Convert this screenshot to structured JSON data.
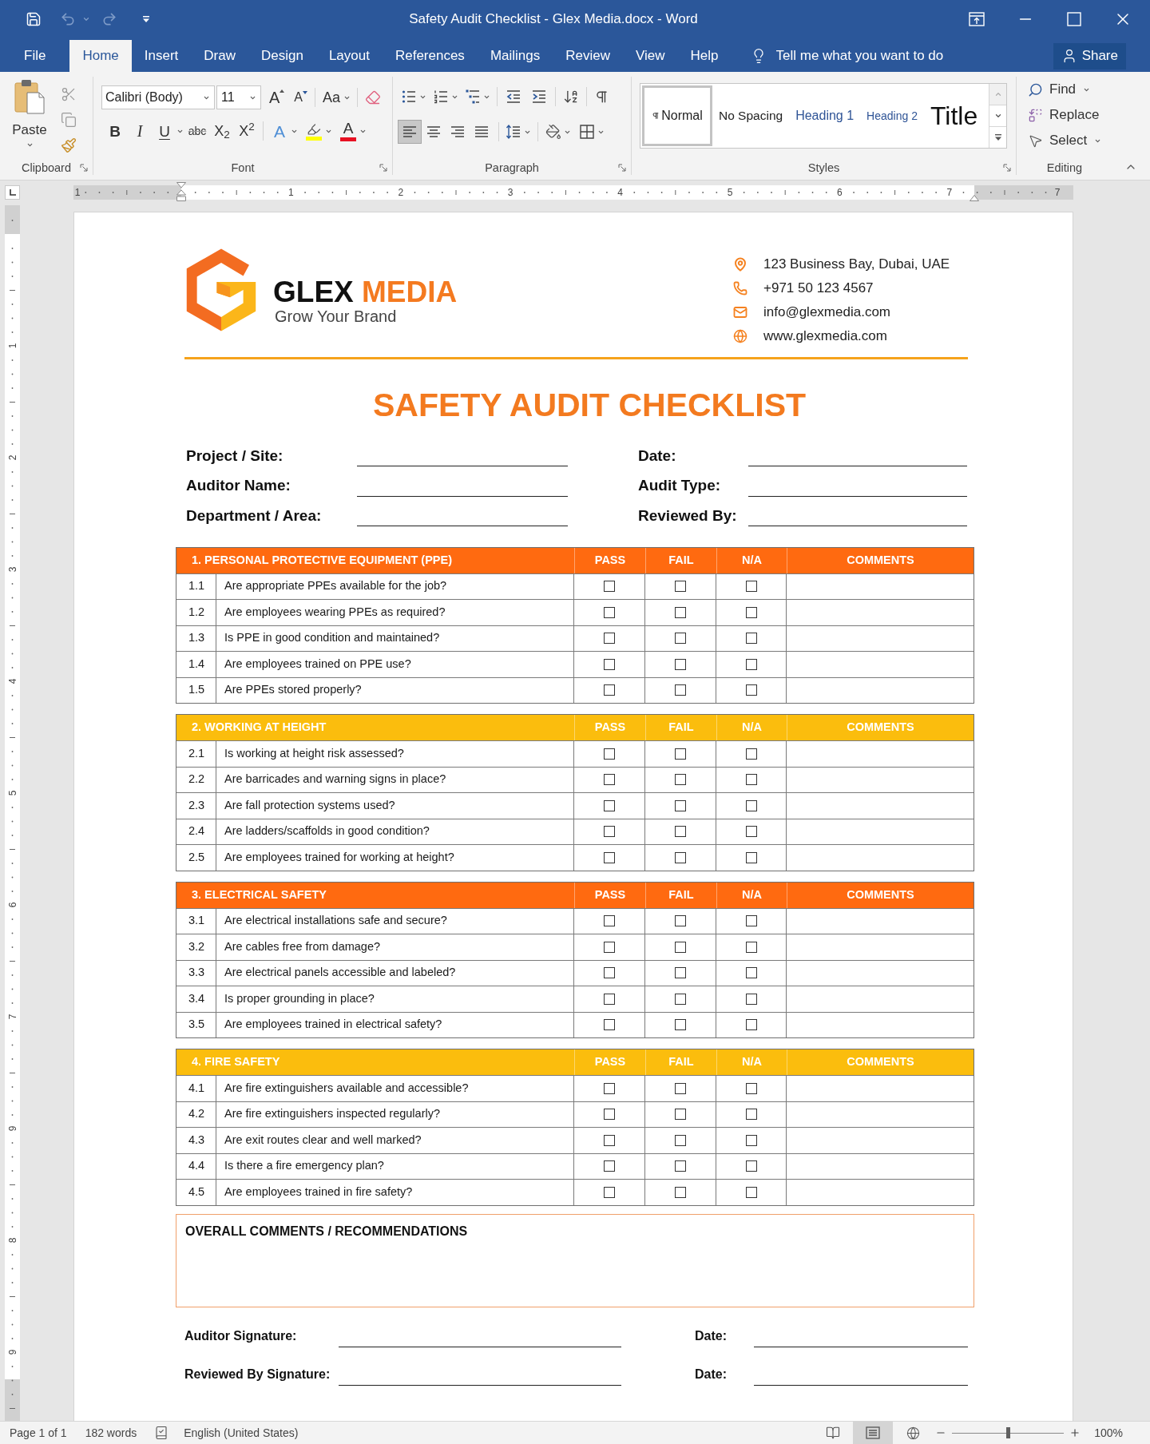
{
  "window": {
    "title": "Safety Audit Checklist - Glex Media.docx - Word"
  },
  "menu_tabs": [
    {
      "label": "File",
      "selected": false
    },
    {
      "label": "Home",
      "selected": true
    },
    {
      "label": "Insert",
      "selected": false
    },
    {
      "label": "Draw",
      "selected": false
    },
    {
      "label": "Design",
      "selected": false
    },
    {
      "label": "Layout",
      "selected": false
    },
    {
      "label": "References",
      "selected": false
    },
    {
      "label": "Mailings",
      "selected": false
    },
    {
      "label": "Review",
      "selected": false
    },
    {
      "label": "View",
      "selected": false
    },
    {
      "label": "Help",
      "selected": false
    }
  ],
  "tell_me": {
    "placeholder": "Tell me what you want to do"
  },
  "share_button": {
    "label": "Share"
  },
  "ribbon": {
    "clipboard": {
      "label": "Clipboard",
      "paste": "Paste"
    },
    "font": {
      "label": "Font",
      "font_name": "Calibri (Body)",
      "font_size": "11",
      "grow": "A",
      "shrink": "A",
      "change_case": "Aa",
      "format_buttons": [
        {
          "kind": "bold",
          "label": "B"
        },
        {
          "kind": "italic",
          "label": "I"
        },
        {
          "kind": "underline",
          "label": "U"
        },
        {
          "kind": "strikethrough",
          "label": "abc"
        },
        {
          "kind": "subscript",
          "label": "X$_{2}$"
        },
        {
          "kind": "superscript",
          "label": "X$^{2}$"
        }
      ],
      "color_buttons": [
        {
          "kind": "effects",
          "label": "A"
        },
        {
          "kind": "highlight",
          "color": "#ffff00"
        },
        {
          "kind": "font_color",
          "label": "A",
          "color": "#e81123"
        }
      ]
    },
    "paragraph": {
      "label": "Paragraph",
      "alignment": [
        {
          "kind": "left",
          "selected": true
        },
        {
          "kind": "center",
          "selected": false
        },
        {
          "kind": "right",
          "selected": false
        },
        {
          "kind": "justify",
          "selected": false
        }
      ]
    },
    "styles": {
      "label": "Styles",
      "items": [
        {
          "kind": "normal",
          "label": "Normal",
          "selected": true
        },
        {
          "kind": "no_spacing",
          "label": "No Spacing",
          "selected": false
        },
        {
          "kind": "heading1",
          "label": "Heading 1",
          "selected": false
        },
        {
          "kind": "heading2",
          "label": "Heading 2",
          "selected": false
        },
        {
          "kind": "title",
          "label": "Title",
          "selected": false
        }
      ]
    },
    "editing": {
      "label": "Editing",
      "items": [
        {
          "kind": "find",
          "label": "Find"
        },
        {
          "kind": "replace",
          "label": "Replace"
        },
        {
          "kind": "select",
          "label": "Select"
        }
      ]
    }
  },
  "ruler": {
    "labels": [
      "1",
      "1",
      "2",
      "3",
      "4",
      "5",
      "6",
      "7",
      "7"
    ]
  },
  "vertical_ruler": {
    "labels": [
      "1",
      "2",
      "3",
      "4",
      "5",
      "6",
      "7",
      "9",
      "8",
      "9"
    ]
  },
  "document": {
    "letterhead": {
      "brand": {
        "first": "GLEX",
        "second": "MEDIA"
      },
      "tagline": "Grow Your Brand",
      "contacts": [
        {
          "kind": "address",
          "text": "123 Business Bay, Dubai, UAE"
        },
        {
          "kind": "phone",
          "text": "+971 50 123 4567"
        },
        {
          "kind": "email",
          "text": "info@glexmedia.com"
        },
        {
          "kind": "web",
          "text": "www.glexmedia.com"
        }
      ]
    },
    "title": "SAFETY AUDIT CHECKLIST",
    "info_fields": [
      {
        "label": "Project / Site:"
      },
      {
        "label": "Date:"
      },
      {
        "label": "Auditor Name:"
      },
      {
        "label": "Audit Type:"
      },
      {
        "label": "Department / Area:"
      },
      {
        "label": "Reviewed By:"
      }
    ],
    "sections": [
      {
        "title": "1. PERSONAL PROTECTIVE EQUIPMENT (PPE)",
        "color": "#ff6a10",
        "columns": [
          "PASS",
          "FAIL",
          "N/A",
          "COMMENTS"
        ],
        "items": [
          {
            "number": "1.1",
            "question": "Are appropriate PPEs available for the job?",
            "checks": [
              {
                "checked": false
              },
              {
                "checked": false
              },
              {
                "checked": false
              }
            ]
          },
          {
            "number": "1.2",
            "question": "Are employees wearing PPEs as required?",
            "checks": [
              {
                "checked": false
              },
              {
                "checked": false
              },
              {
                "checked": false
              }
            ]
          },
          {
            "number": "1.3",
            "question": "Is PPE in good condition and maintained?",
            "checks": [
              {
                "checked": false
              },
              {
                "checked": false
              },
              {
                "checked": false
              }
            ]
          },
          {
            "number": "1.4",
            "question": "Are employees trained on PPE use?",
            "checks": [
              {
                "checked": false
              },
              {
                "checked": false
              },
              {
                "checked": false
              }
            ]
          },
          {
            "number": "1.5",
            "question": "Are PPEs stored properly?",
            "checks": [
              {
                "checked": false
              },
              {
                "checked": false
              },
              {
                "checked": false
              }
            ]
          }
        ]
      },
      {
        "title": "2. WORKING AT HEIGHT",
        "color": "#fbbd0d",
        "columns": [
          "PASS",
          "FAIL",
          "N/A",
          "COMMENTS"
        ],
        "items": [
          {
            "number": "2.1",
            "question": "Is working at height risk assessed?",
            "checks": [
              {
                "checked": false
              },
              {
                "checked": false
              },
              {
                "checked": false
              }
            ]
          },
          {
            "number": "2.2",
            "question": "Are barricades and warning signs in place?",
            "checks": [
              {
                "checked": false
              },
              {
                "checked": false
              },
              {
                "checked": false
              }
            ]
          },
          {
            "number": "2.3",
            "question": "Are fall protection systems used?",
            "checks": [
              {
                "checked": false
              },
              {
                "checked": false
              },
              {
                "checked": false
              }
            ]
          },
          {
            "number": "2.4",
            "question": "Are ladders/scaffolds in good condition?",
            "checks": [
              {
                "checked": false
              },
              {
                "checked": false
              },
              {
                "checked": false
              }
            ]
          },
          {
            "number": "2.5",
            "question": "Are employees trained for working at height?",
            "checks": [
              {
                "checked": false
              },
              {
                "checked": false
              },
              {
                "checked": false
              }
            ]
          }
        ]
      },
      {
        "title": "3. ELECTRICAL SAFETY",
        "color": "#ff6a10",
        "columns": [
          "PASS",
          "FAIL",
          "N/A",
          "COMMENTS"
        ],
        "items": [
          {
            "number": "3.1",
            "question": "Are electrical installations safe and secure?",
            "checks": [
              {
                "checked": false
              },
              {
                "checked": false
              },
              {
                "checked": false
              }
            ]
          },
          {
            "number": "3.2",
            "question": "Are cables free from damage?",
            "checks": [
              {
                "checked": false
              },
              {
                "checked": false
              },
              {
                "checked": false
              }
            ]
          },
          {
            "number": "3.3",
            "question": "Are electrical panels accessible and labeled?",
            "checks": [
              {
                "checked": false
              },
              {
                "checked": false
              },
              {
                "checked": false
              }
            ]
          },
          {
            "number": "3.4",
            "question": "Is proper grounding in place?",
            "checks": [
              {
                "checked": false
              },
              {
                "checked": false
              },
              {
                "checked": false
              }
            ]
          },
          {
            "number": "3.5",
            "question": "Are employees trained in electrical safety?",
            "checks": [
              {
                "checked": false
              },
              {
                "checked": false
              },
              {
                "checked": false
              }
            ]
          }
        ]
      },
      {
        "title": "4. FIRE SAFETY",
        "color": "#fbbd0d",
        "columns": [
          "PASS",
          "FAIL",
          "N/A",
          "COMMENTS"
        ],
        "items": [
          {
            "number": "4.1",
            "question": "Are fire extinguishers available and accessible?",
            "checks": [
              {
                "checked": false
              },
              {
                "checked": false
              },
              {
                "checked": false
              }
            ]
          },
          {
            "number": "4.2",
            "question": "Are fire extinguishers inspected regularly?",
            "checks": [
              {
                "checked": false
              },
              {
                "checked": false
              },
              {
                "checked": false
              }
            ]
          },
          {
            "number": "4.3",
            "question": "Are exit routes clear and well marked?",
            "checks": [
              {
                "checked": false
              },
              {
                "checked": false
              },
              {
                "checked": false
              }
            ]
          },
          {
            "number": "4.4",
            "question": "Is there a fire emergency plan?",
            "checks": [
              {
                "checked": false
              },
              {
                "checked": false
              },
              {
                "checked": false
              }
            ]
          },
          {
            "number": "4.5",
            "question": "Are employees trained in fire safety?",
            "checks": [
              {
                "checked": false
              },
              {
                "checked": false
              },
              {
                "checked": false
              }
            ]
          }
        ]
      }
    ],
    "overall_comments": {
      "title": "OVERALL COMMENTS / RECOMMENDATIONS"
    },
    "signatures": [
      {
        "label": "Auditor Signature:",
        "date_label": "Date:"
      },
      {
        "label": "Reviewed By Signature:",
        "date_label": "Date:"
      }
    ]
  },
  "status_bar": {
    "page": "Page 1 of 1",
    "words": "182 words",
    "language": "English (United States)",
    "views": [
      {
        "kind": "read",
        "selected": false
      },
      {
        "kind": "print",
        "selected": true
      },
      {
        "kind": "web",
        "selected": false
      }
    ],
    "zoom": {
      "level": 0.5,
      "label": "100%"
    }
  }
}
